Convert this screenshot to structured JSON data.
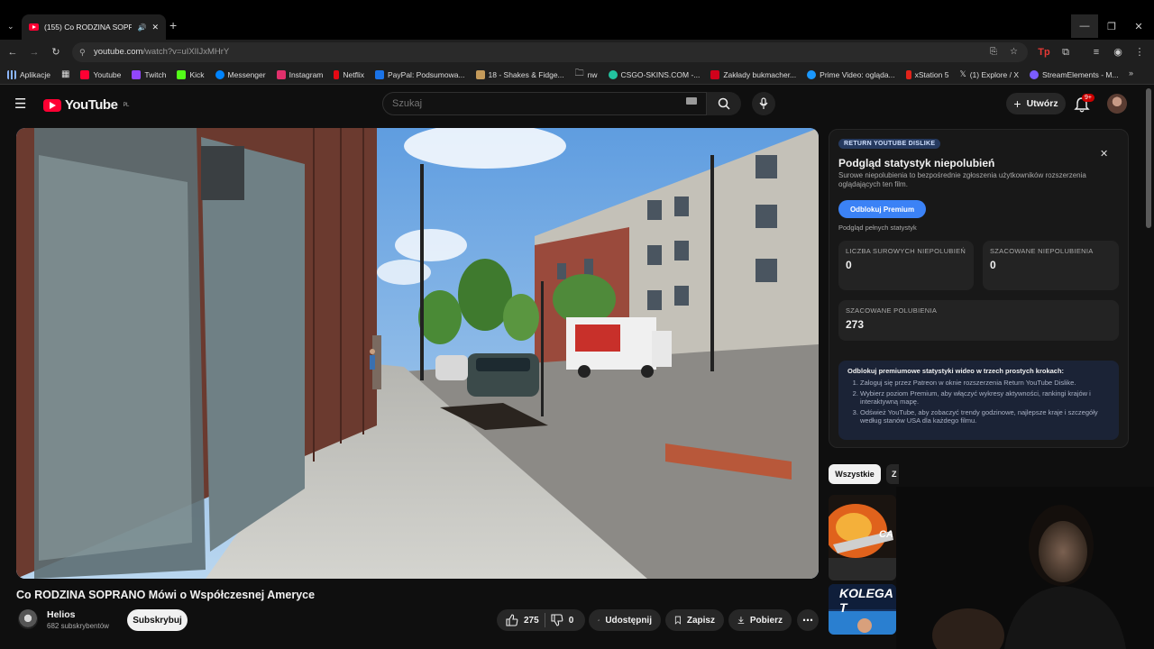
{
  "browser": {
    "tab_title": "(155) Co RODZINA SOPRAN",
    "url_host": "youtube.com",
    "url_path": "/watch?v=uIXlIJxMHrY",
    "bookmarks": [
      {
        "label": "Aplikacje",
        "color": "#8ab4f8"
      },
      {
        "label": "Youtube",
        "color": "#ff0033"
      },
      {
        "label": "Twitch",
        "color": "#9146ff"
      },
      {
        "label": "Kick",
        "color": "#53fc18"
      },
      {
        "label": "Messenger",
        "color": "#0084ff"
      },
      {
        "label": "Instagram",
        "color": "#e1306c"
      },
      {
        "label": "Netflix",
        "color": "#e50914"
      },
      {
        "label": "PayPal: Podsumowa...",
        "color": "#1a73e8"
      },
      {
        "label": "18 - Shakes & Fidge...",
        "color": "#c49a5a"
      },
      {
        "label": "nw",
        "color": "#999999"
      },
      {
        "label": "CSGO-SKINS.COM -...",
        "color": "#22c3a0"
      },
      {
        "label": "Zakłady bukmacher...",
        "color": "#d0021b"
      },
      {
        "label": "Prime Video: ogląda...",
        "color": "#1a98ff"
      },
      {
        "label": "xStation 5",
        "color": "#e2231a"
      },
      {
        "label": "(1) Explore / X",
        "color": "#ffffff"
      },
      {
        "label": "StreamElements - M...",
        "color": "#7b5cff"
      }
    ]
  },
  "youtube": {
    "logo_text": "YouTube",
    "logo_region": "PL",
    "search_placeholder": "Szukaj",
    "create_label": "Utwórz",
    "notifications_badge": "9+"
  },
  "video": {
    "title": "Co RODZINA SOPRANO Mówi o Współczesnej Ameryce",
    "channel_name": "Helios",
    "channel_subs": "682 subskrybentów",
    "subscribe_label": "Subskrybuj",
    "likes": "275",
    "dislikes": "0",
    "share_label": "Udostępnij",
    "save_label": "Zapisz",
    "download_label": "Pobierz"
  },
  "ryd": {
    "tag": "RETURN YOUTUBE DISLIKE",
    "title": "Podgląd statystyk niepolubień",
    "description": "Surowe niepolubienia to bezpośrednie zgłoszenia użytkowników rozszerzenia oglądających ten film.",
    "unlock_label": "Odblokuj Premium",
    "full_stats": "Podgląd pełnych statystyk",
    "raw_dislikes_label": "LICZBA SUROWYCH NIEPOLUBIEŃ",
    "raw_dislikes_value": "0",
    "est_dislikes_label": "SZACOWANE NIEPOLUBIENIA",
    "est_dislikes_value": "0",
    "est_likes_label": "SZACOWANE POLUBIENIA",
    "est_likes_value": "273",
    "steps_heading": "Odblokuj premiumowe statystyki wideo w trzech prostych krokach:",
    "steps": [
      "Zaloguj się przez Patreon w oknie rozszerzenia Return YouTube Dislike.",
      "Wybierz poziom Premium, aby włączyć wykresy aktywności, rankingi krajów i interaktywną mapę.",
      "Odśwież YouTube, aby zobaczyć trendy godzinowe, najlepsze kraje i szczegóły według stanów USA dla każdego filmu."
    ]
  },
  "chips": {
    "all": "Wszystkie",
    "second": "Z"
  },
  "thumbnails": {
    "first_text": "CA",
    "second_text": "KOLEGA T"
  }
}
